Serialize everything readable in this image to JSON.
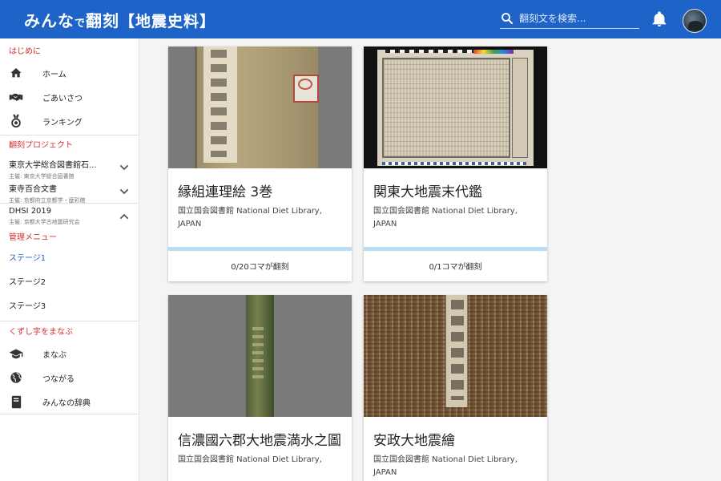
{
  "header": {
    "logo_main": "みんな",
    "logo_small": "で",
    "logo_title": "翻刻",
    "logo_sub": "【地震史料】",
    "search_placeholder": "翻刻文を検索..."
  },
  "sidebar": {
    "intro_title": "はじめに",
    "intro_items": [
      {
        "label": "ホーム",
        "icon": "home-icon"
      },
      {
        "label": "ごあいさつ",
        "icon": "handshake-icon"
      },
      {
        "label": "ランキング",
        "icon": "medal-icon"
      }
    ],
    "projects_title": "翻刻プロジェクト",
    "projects": [
      {
        "title": "東京大学総合図書館石...",
        "sub": "主催: 東京大学総合図書館",
        "expanded": false
      },
      {
        "title": "東寺百合文書",
        "sub": "主催: 京都府立京都学・歴彩館",
        "expanded": false
      },
      {
        "title": "DHSI 2019",
        "sub": "主催: 京都大学古地震研究会",
        "expanded": true
      }
    ],
    "admin_title": "管理メニュー",
    "stages": [
      "ステージ1",
      "ステージ2",
      "ステージ3"
    ],
    "learn_title": "くずし字をまなぶ",
    "learn_items": [
      {
        "label": "まなぶ",
        "icon": "graduation-cap-icon"
      },
      {
        "label": "つながる",
        "icon": "globe-icon"
      },
      {
        "label": "みんなの辞典",
        "icon": "dictionary-icon"
      }
    ]
  },
  "cards": [
    {
      "title": "縁組連理絵 3巻",
      "sub": "国立国会図書館 National Diet Library, JAPAN",
      "count": "0/20コマが翻刻",
      "progress": 0
    },
    {
      "title": "関東大地震末代鑑",
      "sub": "国立国会図書館 National Diet Library, JAPAN",
      "count": "0/1コマが翻刻",
      "progress": 0
    },
    {
      "title": "信濃國六郡大地震満水之圖",
      "sub": "国立国会図書館 National Diet Library,",
      "count": "",
      "progress": 0
    },
    {
      "title": "安政大地震繪",
      "sub": "国立国会図書館 National Diet Library, JAPAN",
      "count": "",
      "progress": 0
    }
  ],
  "colors": {
    "header": "#1e64c8",
    "section_title": "#d32f2f",
    "active_stage": "#1e64c8",
    "progress_track": "#bcdcf4"
  }
}
